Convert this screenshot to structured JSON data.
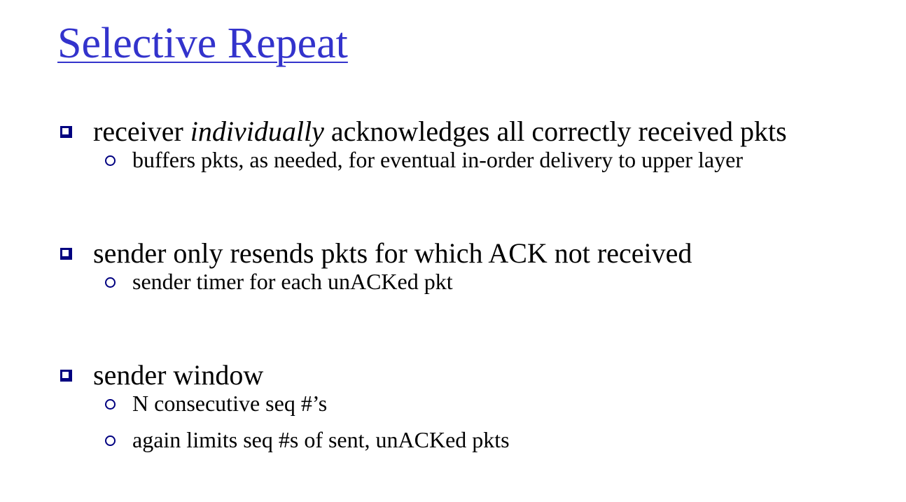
{
  "slide": {
    "title": "Selective Repeat",
    "bullets": [
      {
        "pre": "receiver ",
        "emph": "individually",
        "post": " acknowledges all correctly received pkts",
        "subs": [
          "buffers pkts, as needed, for eventual in-order delivery to upper layer"
        ]
      },
      {
        "text": "sender only resends pkts for which ACK not received",
        "subs": [
          "sender timer for each unACKed pkt"
        ]
      },
      {
        "text": "sender window",
        "subs": [
          "N consecutive seq #’s",
          "again limits seq #s of sent, unACKed pkts"
        ]
      }
    ]
  },
  "colors": {
    "title": "#3333cc",
    "bullet_icon": "#000080",
    "text": "#000000",
    "background": "#ffffff"
  },
  "icons": {
    "main_bullet": "square-bullet-icon",
    "sub_bullet": "circle-bullet-icon"
  }
}
